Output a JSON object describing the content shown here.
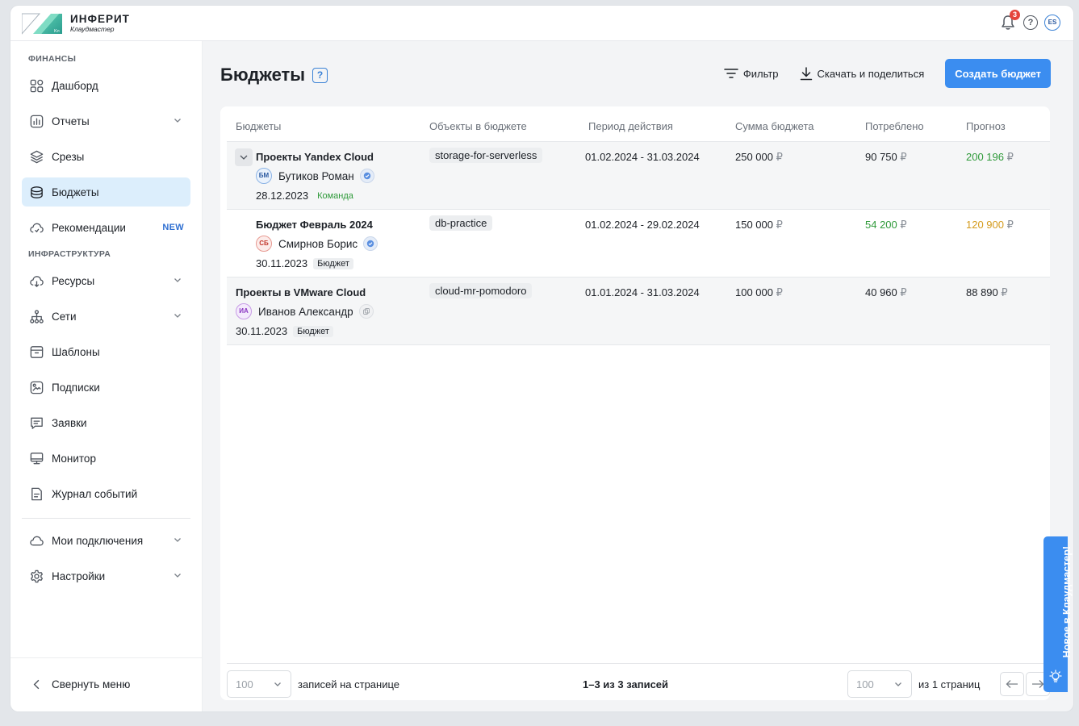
{
  "app": {
    "logo_title": "ИНФЕРИТ",
    "logo_subtitle": "Клаудмастер",
    "logo_mark_text": "Кл",
    "notifications_count": "3",
    "help_glyph": "?",
    "user_initials": "ES"
  },
  "sidebar": {
    "sections": [
      {
        "title": "ФИНАНСЫ",
        "items": [
          {
            "label": "Дашборд",
            "icon": "dashboard-grid-icon",
            "chevron": false
          },
          {
            "label": "Отчеты",
            "icon": "reports-chart-icon",
            "chevron": true
          },
          {
            "label": "Срезы",
            "icon": "layers-icon",
            "chevron": false
          },
          {
            "label": "Бюджеты",
            "icon": "budget-coins-icon",
            "chevron": false,
            "active": true
          },
          {
            "label": "Рекомендации",
            "icon": "cloud-recommend-icon",
            "chevron": false,
            "tag": "NEW"
          }
        ]
      },
      {
        "title": "ИНФРАСТРУКТУРА",
        "items": [
          {
            "label": "Ресурсы",
            "icon": "cloud-resources-icon",
            "chevron": true
          },
          {
            "label": "Сети",
            "icon": "network-tree-icon",
            "chevron": true
          },
          {
            "label": "Шаблоны",
            "icon": "archive-box-icon",
            "chevron": false
          },
          {
            "label": "Подписки",
            "icon": "subscription-image-icon",
            "chevron": false
          },
          {
            "label": "Заявки",
            "icon": "message-lines-icon",
            "chevron": false
          },
          {
            "label": "Монитор",
            "icon": "monitor-icon",
            "chevron": false
          },
          {
            "label": "Журнал событий",
            "icon": "event-log-icon",
            "chevron": false
          }
        ]
      }
    ],
    "bottom_items": [
      {
        "label": "Мои подключения",
        "icon": "cloud-connections-icon",
        "chevron": true
      },
      {
        "label": "Настройки",
        "icon": "gear-icon",
        "chevron": true
      }
    ],
    "collapse_label": "Свернуть меню"
  },
  "header": {
    "title": "Бюджеты",
    "help_glyph": "?",
    "filter_label": "Фильтр",
    "download_label": "Скачать и поделиться",
    "create_label": "Создать бюджет"
  },
  "table": {
    "columns": [
      "Бюджеты",
      "Объекты в бюджете",
      "Период действия",
      "Сумма бюджета",
      "Потреблено",
      "Прогноз"
    ],
    "currency": "₽",
    "rows": [
      {
        "name": "Проекты Yandex Cloud",
        "owner_initials": "БМ",
        "owner_name": "Бутиков Роман",
        "date": "28.12.2023",
        "tag": "Команда",
        "object": "storage-for-serverless",
        "period": "01.02.2024 - 31.03.2024",
        "amount": "250 000",
        "consumed": "90 750",
        "forecast": "200 196",
        "consumed_color": "default",
        "forecast_color": "green"
      },
      {
        "name": "Бюджет Февраль 2024",
        "owner_initials": "СБ",
        "owner_name": "Смирнов Борис",
        "date": "30.11.2023",
        "tag": "Бюджет",
        "object": "db-practice",
        "period": "01.02.2024 - 29.02.2024",
        "amount": "150 000",
        "consumed": "54 200",
        "forecast": "120 900",
        "consumed_color": "green",
        "forecast_color": "amber"
      },
      {
        "name": "Проекты в VMware Cloud",
        "owner_initials": "ИА",
        "owner_name": "Иванов Александр",
        "date": "30.11.2023",
        "tag": "Бюджет",
        "object": "cloud-mr-pomodoro",
        "period": "01.01.2024 - 31.03.2024",
        "amount": "100 000",
        "consumed": "40 960",
        "forecast": "88 890",
        "consumed_color": "default",
        "forecast_color": "default"
      }
    ]
  },
  "footer": {
    "page_size": "100",
    "page_size_label": "записей на странице",
    "records_summary": "1–3 из 3 записей",
    "page_number": "100",
    "pages_label": "из 1 страниц"
  },
  "news_tab": {
    "label": "Новое в Клаудмастер!"
  },
  "colors": {
    "accent": "#3b8df0",
    "active_nav": "#dceefc",
    "green": "#2f9a3a",
    "amber": "#d49b1d",
    "badge": "#e5453b"
  }
}
